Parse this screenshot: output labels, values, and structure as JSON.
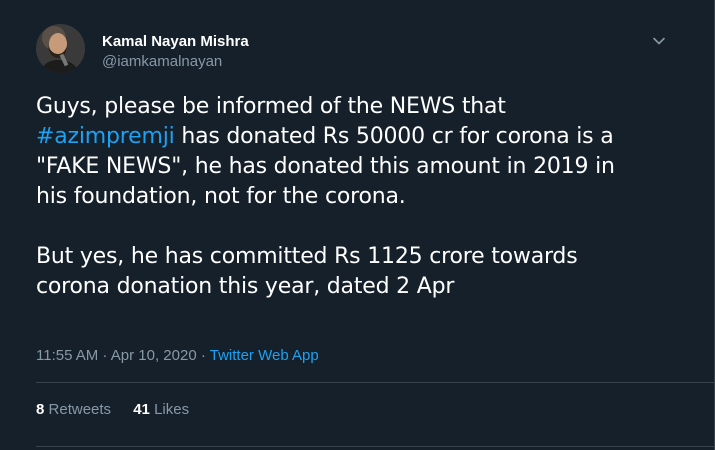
{
  "author": {
    "name": "Kamal Nayan Mishra",
    "handle": "@iamkamalnayan"
  },
  "tweet": {
    "line1": "Guys, please be informed of the NEWS that",
    "hashtag": "#azimpremji",
    "line2_rest": " has donated Rs 50000 cr for corona is a",
    "line3": "\"FAKE NEWS\", he has donated this amount in 2019 in",
    "line4": "his foundation, not for the corona.",
    "line5": "But yes, he has committed Rs 1125 crore towards",
    "line6": "corona donation this year, dated 2 Apr"
  },
  "meta": {
    "time": "11:55 AM",
    "separator1": " · ",
    "date": "Apr 10, 2020",
    "separator2": " · ",
    "source": "Twitter Web App"
  },
  "stats": {
    "retweets_count": "8",
    "retweets_label": "Retweets",
    "likes_count": "41",
    "likes_label": "Likes"
  },
  "icons": {
    "more": "chevron-down-icon"
  },
  "colors": {
    "background": "#15202b",
    "accent": "#1da1f2",
    "secondary_text": "#8899a6",
    "border": "#38444d"
  }
}
